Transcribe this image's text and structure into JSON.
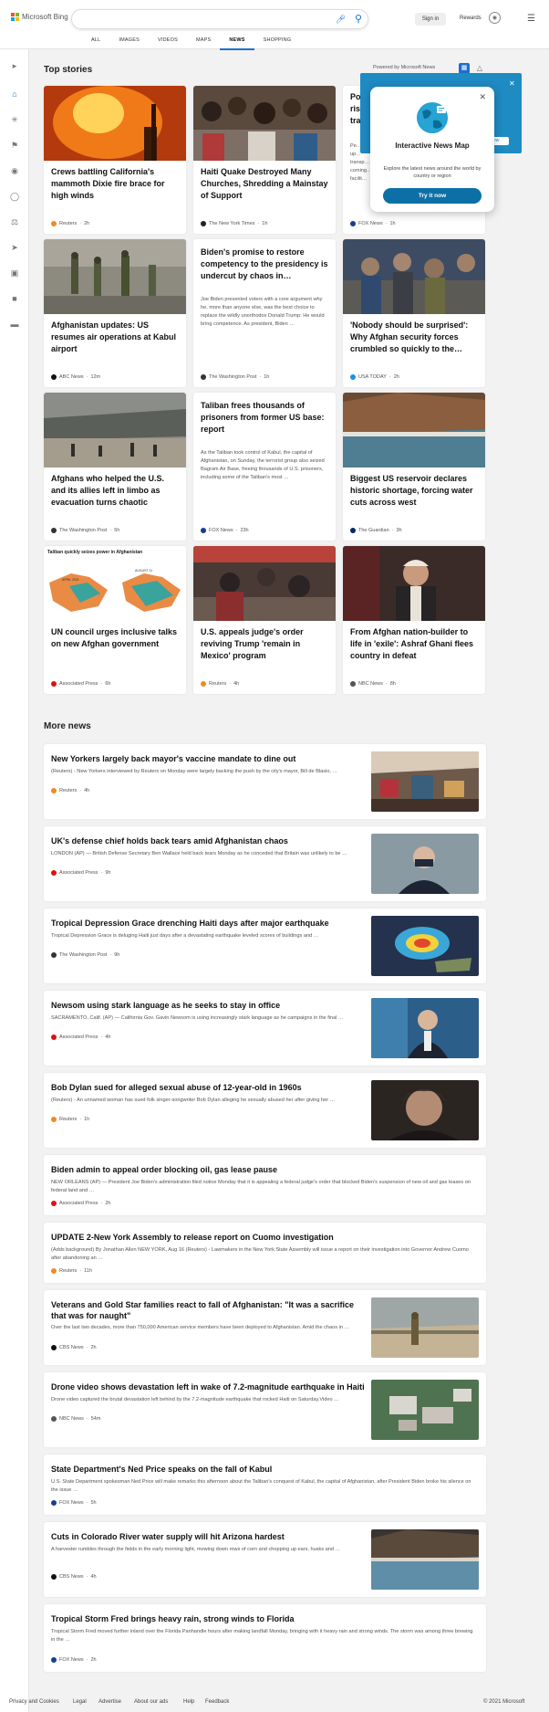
{
  "header": {
    "brand": "Microsoft Bing",
    "sign_in": "Sign in",
    "rewards": "Rewards"
  },
  "nav": [
    {
      "label": "ALL",
      "active": false
    },
    {
      "label": "IMAGES",
      "active": false
    },
    {
      "label": "VIDEOS",
      "active": false
    },
    {
      "label": "MAPS",
      "active": false
    },
    {
      "label": "NEWS",
      "active": true
    },
    {
      "label": "SHOPPING",
      "active": false
    }
  ],
  "top_stories": {
    "heading": "Top stories",
    "powered": "Powered by Microsoft News"
  },
  "popup": {
    "title": "Interactive News Map",
    "desc": "Explore the latest news around the world by country or region",
    "button": "Try it now",
    "behind_label": "to",
    "behind_button": "ow"
  },
  "cards": [
    {
      "title": "Crews battling California's mammoth Dixie fire brace for high winds",
      "source": "Reuters",
      "time": "2h"
    },
    {
      "title": "Haiti Quake Destroyed Many Churches, Shredding a Mainstay of Support",
      "source": "The New York Times",
      "time": "1h"
    },
    {
      "title": "Po… ris… tra…",
      "desc": "Pe… that up… transp… coming… facilit…",
      "source": "FOX News",
      "time": "1h"
    },
    {
      "title": "Afghanistan updates: US resumes air operations at Kabul airport",
      "source": "ABC News",
      "time": "12m"
    },
    {
      "title": "Biden's promise to restore competency to the presidency is undercut by chaos in…",
      "desc": "Joe Biden presented voters with a core argument why he, more than anyone else, was the best choice to replace the wildly unorthodox Donald Trump: He would bring competence. As president, Biden …",
      "source": "The Washington Post",
      "time": "1h"
    },
    {
      "title": "'Nobody should be surprised': Why Afghan security forces crumbled so quickly to the…",
      "source": "USA TODAY",
      "time": "2h"
    },
    {
      "title": "Afghans who helped the U.S. and its allies left in limbo as evacuation turns chaotic",
      "source": "The Washington Post",
      "time": "5h"
    },
    {
      "title": "Taliban frees thousands of prisoners from former US base: report",
      "desc": "As the Taliban took control of Kabul, the capital of Afghanistan, on Sunday, the terrorist group also seized Bagram Air Base, freeing thousands of U.S. prisoners, including some of the Taliban's most …",
      "source": "FOX News",
      "time": "23h"
    },
    {
      "title": "Biggest US reservoir declares historic shortage, forcing water cuts across west",
      "source": "The Guardian",
      "time": "3h"
    },
    {
      "title": "UN council urges inclusive talks on new Afghan government",
      "source": "Associated Press",
      "time": "6h",
      "map_title": "Taliban quickly seizes power in Afghanistan",
      "map_left": "APRIL 2021",
      "map_right": "AUGUST 11"
    },
    {
      "title": "U.S. appeals judge's order reviving Trump 'remain in Mexico' program",
      "source": "Reuters",
      "time": "4h"
    },
    {
      "title": "From Afghan nation-builder to life in 'exile': Ashraf Ghani flees country in defeat",
      "source": "NBC News",
      "time": "8h"
    }
  ],
  "more_news": {
    "heading": "More news",
    "items": [
      {
        "title": "New Yorkers largely back mayor's vaccine mandate to dine out",
        "desc": "(Reuters) - New Yorkers interviewed by Reuters on Monday were largely backing the push by the city's mayor, Bill de Blasio, …",
        "source": "Reuters",
        "time": "4h"
      },
      {
        "title": "UK's defense chief holds back tears amid Afghanistan chaos",
        "desc": "LONDON (AP) — British Defense Secretary Ben Wallace held back tears Monday as he conceded that Britain was unlikely to be …",
        "source": "Associated Press",
        "time": "9h"
      },
      {
        "title": "Tropical Depression Grace drenching Haiti days after major earthquake",
        "desc": "Tropical Depression Grace is deluging Haiti just days after a devastating earthquake leveled scores of buildings and …",
        "source": "The Washington Post",
        "time": "9h"
      },
      {
        "title": "Newsom using stark language as he seeks to stay in office",
        "desc": "SACRAMENTO, Calif. (AP) — California Gov. Gavin Newsom is using increasingly stark language as he campaigns in the final …",
        "source": "Associated Press",
        "time": "4h"
      },
      {
        "title": "Bob Dylan sued for alleged sexual abuse of 12-year-old in 1960s",
        "desc": "(Reuters) - An unnamed woman has sued folk singer-songwriter Bob Dylan alleging he sexually abused her after giving her …",
        "source": "Reuters",
        "time": "1h"
      },
      {
        "title": "Biden admin to appeal order blocking oil, gas lease pause",
        "desc": "NEW ORLEANS (AP) — President Joe Biden's administration filed notice Monday that it is appealing a federal judge's order that blocked Biden's suspension of new oil and gas leases on federal land and …",
        "source": "Associated Press",
        "time": "2h"
      },
      {
        "title": "UPDATE 2-New York Assembly to release report on Cuomo investigation",
        "desc": "(Adds background) By Jonathan Allen NEW YORK, Aug 16 (Reuters) - Lawmakers in the New York State Assembly will issue a report on their investigation into Governor Andrew Cuomo after abandoning an …",
        "source": "Reuters",
        "time": "11h"
      },
      {
        "title": "Veterans and Gold Star families react to fall of Afghanistan: \"It was a sacrifice that was for naught\"",
        "desc": "Over the last two decades, more than 750,000 American service members have been deployed to Afghanistan. Amid the chaos in …",
        "source": "CBS News",
        "time": "2h"
      },
      {
        "title": "Drone video shows devastation left in wake of 7.2-magnitude earthquake in Haiti",
        "desc": "Drone video captured the brutal devastation left behind by the 7.2-magnitude earthquake that rocked Haiti on Saturday.Video …",
        "source": "NBC News",
        "time": "54m"
      },
      {
        "title": "State Department's Ned Price speaks on the fall of Kabul",
        "desc": "U.S. State Department spokesman Ned Price will make remarks this afternoon about the Taliban's conquest of Kabul, the capital of Afghanistan, after President Biden broke his silence on the issue …",
        "source": "FOX News",
        "time": "5h"
      },
      {
        "title": "Cuts in Colorado River water supply will hit Arizona hardest",
        "desc": "A harvester rumbles through the fields in the early morning light, mowing down rows of corn and chopping up ears, husks and …",
        "source": "CBS News",
        "time": "4h"
      },
      {
        "title": "Tropical Storm Fred brings heavy rain, strong winds to Florida",
        "desc": "Tropical Storm Fred moved further inland over the Florida Panhandle hours after making landfall Monday, bringing with it heavy rain and strong winds.  The storm was among three brewing in the …",
        "source": "FOX News",
        "time": "2h"
      }
    ]
  },
  "footer": {
    "links": [
      "Privacy and Cookies",
      "Legal",
      "Advertise",
      "About our ads",
      "Help",
      "Feedback"
    ],
    "copyright": "© 2021 Microsoft"
  }
}
